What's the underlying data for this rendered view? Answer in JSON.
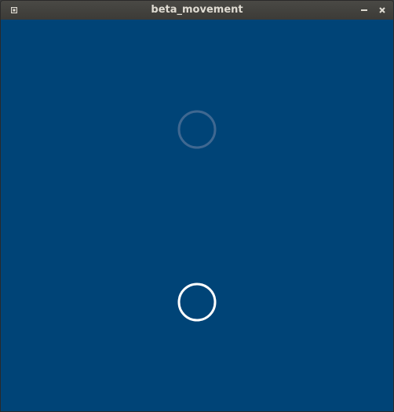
{
  "window": {
    "title": "beta_movement",
    "buttons": {
      "menu_icon": "window-menu-icon",
      "minimize_icon": "minimize-icon",
      "close_icon": "close-icon"
    }
  },
  "canvas": {
    "background_color": "#004477",
    "circles": [
      {
        "name": "faded-circle",
        "stroke_color": "#3f6891"
      },
      {
        "name": "bright-circle",
        "stroke_color": "#ffffff"
      }
    ]
  }
}
